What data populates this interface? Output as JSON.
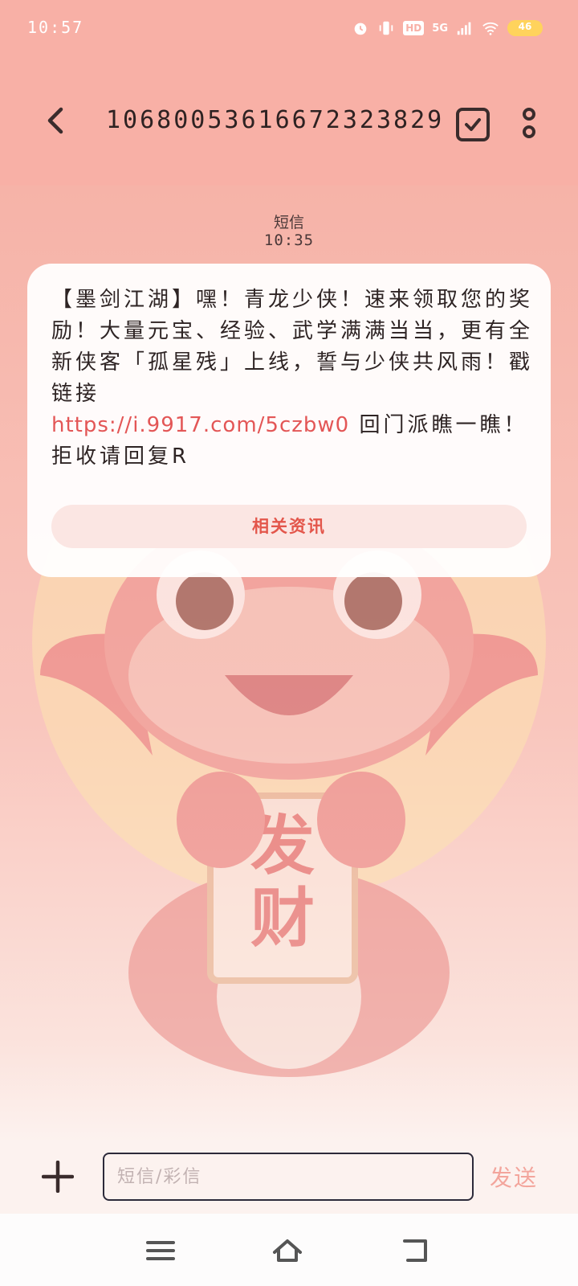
{
  "status_bar": {
    "time": "10:57",
    "hd": "HD",
    "network": "5G",
    "battery": "46"
  },
  "header": {
    "sender": "10680053616672323829"
  },
  "thread": {
    "message_type": "短信",
    "message_time": "10:35"
  },
  "message": {
    "text_before_link": "【墨剑江湖】嘿！青龙少侠！速来领取您的奖励！大量元宝、经验、武学满满当当，更有全新侠客「孤星残」上线，誓与少侠共风雨！戳链接",
    "link": "https://i.9917.com/5czbw0",
    "text_after_link": " 回门派瞧一瞧！拒收请回复R",
    "related_button": "相关资讯"
  },
  "mascot": {
    "sign_text": "发财"
  },
  "composer": {
    "placeholder": "短信/彩信",
    "send_label": "发送"
  },
  "colors": {
    "header_bg": "#f8b0a6",
    "link": "#e35656",
    "send": "#f3a59c",
    "dragon": "#e96b6b"
  }
}
